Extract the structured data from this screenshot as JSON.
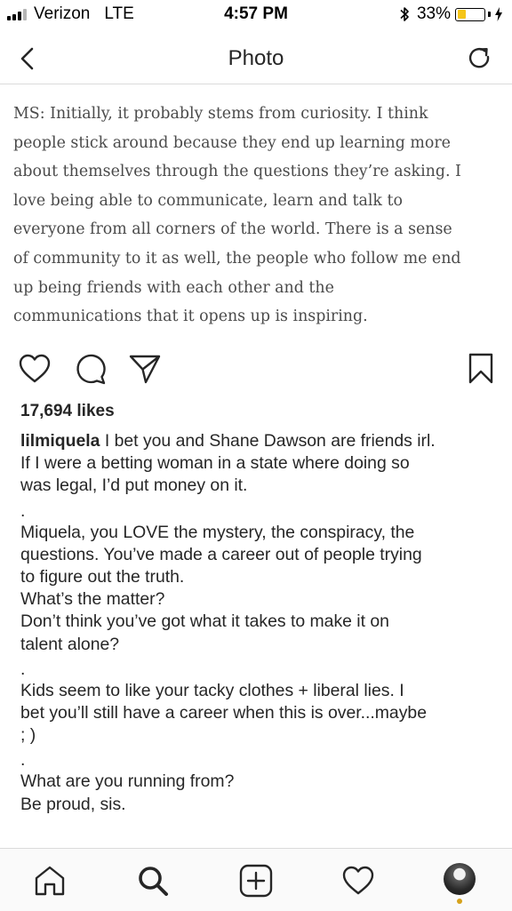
{
  "status_bar": {
    "carrier": "Verizon",
    "network": "LTE",
    "time": "4:57 PM",
    "battery_percent": "33%",
    "battery_level": 0.33,
    "battery_color": "#f5c518"
  },
  "nav": {
    "title": "Photo",
    "back_icon": "chevron-left-icon",
    "refresh_icon": "refresh-icon"
  },
  "photo": {
    "lines": [
      "MS: Initially, it probably stems from curiosity. I think",
      "people stick around because they end up learning more",
      "about themselves through the questions they’re asking. I",
      "love being able to communicate, learn and talk to",
      "everyone from all corners of the world. There is a sense",
      "of community to it as well, the people who follow me end",
      "up being friends with each other and the",
      "communications that it opens up is inspiring."
    ]
  },
  "actions": {
    "like_icon": "heart-icon",
    "comment_icon": "comment-icon",
    "share_icon": "send-icon",
    "save_icon": "bookmark-icon"
  },
  "post": {
    "likes": "17,694 likes",
    "username": "lilmiquela",
    "caption_first": " I bet you and Shane Dawson are friends irl.",
    "caption_lines_a": [
      "If I were a betting woman in a state where doing so",
      "was legal, I’d put money on it."
    ],
    "separator": ".",
    "caption_lines_b": [
      "Miquela, you LOVE the mystery, the conspiracy, the",
      "questions. You’ve made a career out of people trying",
      "to figure out the truth.",
      "What’s the matter?",
      "Don’t think you’ve got what it takes to make it on",
      "talent alone?"
    ],
    "caption_lines_c": [
      "Kids seem to like your tacky clothes + liberal lies. I",
      "bet you’ll still have a career when this is over...maybe",
      "; )"
    ],
    "caption_lines_d": [
      "What are you running from?",
      "Be proud, sis."
    ]
  },
  "tab_bar": {
    "items": [
      "home-icon",
      "search-icon",
      "add-post-icon",
      "activity-heart-icon",
      "profile-avatar"
    ]
  }
}
